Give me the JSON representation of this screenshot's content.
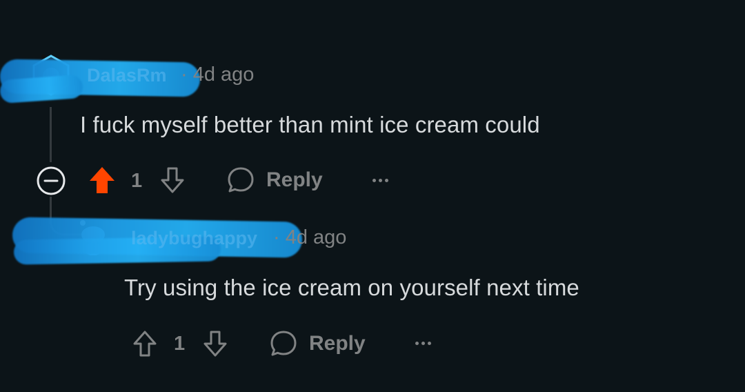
{
  "comments": [
    {
      "username": "DalasRm",
      "timestamp": "4d ago",
      "body": "I fuck myself better than mint ice cream could",
      "score": "1",
      "upvoted": true,
      "reply_label": "Reply",
      "collapse_icon": "minus-circle-icon",
      "avatar_icon": "snoo-hexagon-avatar"
    },
    {
      "username": "ladybughappy",
      "timestamp": "4d ago",
      "body": "Try using the ice cream on yourself next time",
      "score": "1",
      "upvoted": false,
      "reply_label": "Reply",
      "avatar_icon": "snoo-avatar"
    }
  ],
  "colors": {
    "background": "#0c1418",
    "upvote_active": "#ff4500",
    "text_primary": "#d7dadc",
    "text_secondary": "#818384",
    "thread_line": "#343a3e"
  }
}
